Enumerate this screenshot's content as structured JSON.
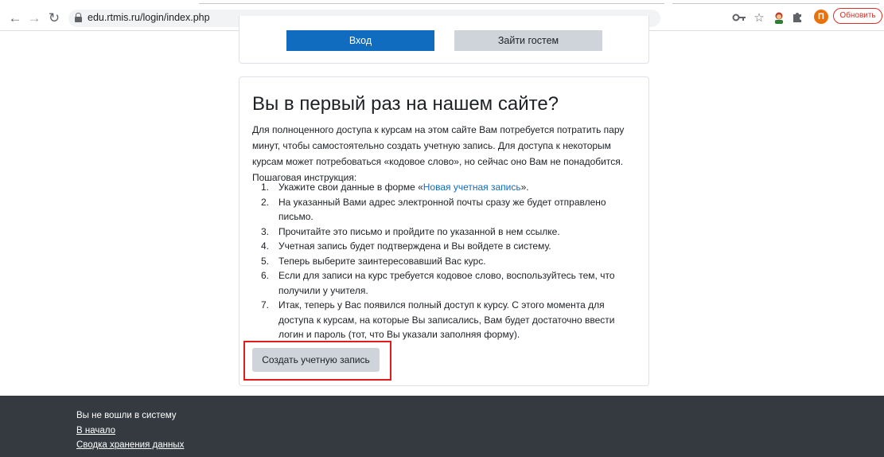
{
  "browser": {
    "url": "edu.rtmis.ru/login/index.php",
    "update_button": "Обновить",
    "profile_initial": "П"
  },
  "login": {
    "login_button": "Вход",
    "guest_button": "Зайти гостем"
  },
  "info": {
    "title": "Вы в первый раз на нашем сайте?",
    "paragraph_lines": [
      "Для полноценного доступа к курсам на этом сайте Вам потребуется потратить пару",
      "минут, чтобы самостоятельно создать учетную запись. Для доступа к некоторым",
      "курсам может потребоваться «кодовое слово», но сейчас оно Вам не понадобится.",
      "Пошаговая инструкция:"
    ],
    "steps": [
      {
        "num": "1.",
        "pre": "Укажите свои данные в форме «",
        "link": "Новая учетная запись",
        "post": "»."
      },
      {
        "num": "2.",
        "lines": [
          "На указанный Вами адрес электронной почты сразу же будет отправлено",
          "письмо."
        ]
      },
      {
        "num": "3.",
        "lines": [
          "Прочитайте это письмо и пройдите по указанной в нем ссылке."
        ]
      },
      {
        "num": "4.",
        "lines": [
          "Учетная запись будет подтверждена и Вы войдете в систему."
        ]
      },
      {
        "num": "5.",
        "lines": [
          "Теперь выберите заинтересовавший Вас курс."
        ]
      },
      {
        "num": "6.",
        "lines": [
          "Если для записи на курс требуется кодовое слово, воспользуйтесь тем, что",
          "получили у учителя."
        ]
      },
      {
        "num": "7.",
        "lines": [
          "Итак, теперь у Вас появился полный доступ к курсу. С этого момента для",
          "доступа к курсам, на которые Вы записались, Вам будет достаточно ввести",
          "логин и пароль (тот, что Вы указали заполняя форму)."
        ]
      }
    ],
    "create_button": "Создать учетную запись"
  },
  "footer": {
    "not_logged_in": "Вы не вошли в систему",
    "home_link": "В начало",
    "data_retention_link": "Сводка хранения данных"
  },
  "colors": {
    "primary": "#0f6cbf",
    "secondary": "#ced4da",
    "footer_bg": "#343a40",
    "highlight": "#e21c1c",
    "update_red": "#d93025"
  }
}
